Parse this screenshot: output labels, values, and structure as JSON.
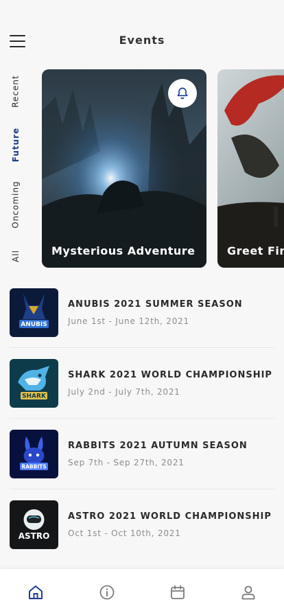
{
  "header": {
    "title": "Events",
    "menu_icon": "hamburger-menu-icon"
  },
  "side_tabs": [
    {
      "label": "Recent",
      "active": false
    },
    {
      "label": "Future",
      "active": true
    },
    {
      "label": "Oncoming",
      "active": false
    },
    {
      "label": "All",
      "active": false
    }
  ],
  "featured": [
    {
      "title": "Mysterious Adventure",
      "icon": "bell-icon"
    },
    {
      "title": "Greet Fin"
    }
  ],
  "events": [
    {
      "title": "ANUBIS 2021 SUMMER SEASON",
      "date": "June 1st - June 12th, 2021",
      "logo_text": "ANUBIS"
    },
    {
      "title": "SHARK 2021 WORLD CHAMPIONSHIP",
      "date": "July 2nd - July 7th, 2021",
      "logo_text": "SHARK"
    },
    {
      "title": "RABBITS 2021 AUTUMN SEASON",
      "date": "Sep 7th - Sep 27th, 2021",
      "logo_text": "RABBITS"
    },
    {
      "title": "ASTRO 2021 WORLD CHAMPIONSHIP",
      "date": "Oct 1st - Oct 10th, 2021",
      "logo_text": "ASTRO"
    }
  ],
  "tabbar": [
    {
      "name": "home",
      "icon": "home-icon",
      "active": true
    },
    {
      "name": "info",
      "icon": "info-icon",
      "active": false
    },
    {
      "name": "calendar",
      "icon": "calendar-icon",
      "active": false
    },
    {
      "name": "profile",
      "icon": "user-icon",
      "active": false
    }
  ],
  "colors": {
    "accent": "#1f3c8c",
    "text": "#2a2a2a",
    "muted": "#8c8c8c",
    "background": "#f7f7f7"
  }
}
